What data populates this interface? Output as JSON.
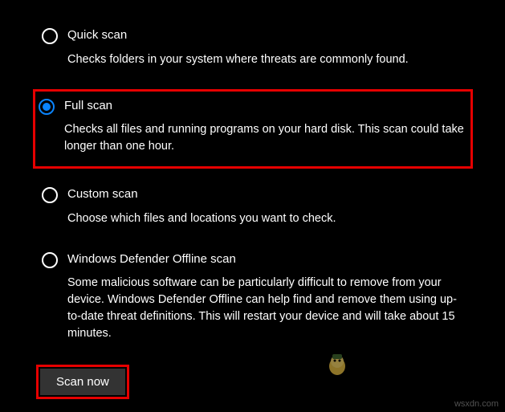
{
  "options": [
    {
      "title": "Quick scan",
      "description": "Checks folders in your system where threats are commonly found.",
      "selected": false,
      "highlighted": false
    },
    {
      "title": "Full scan",
      "description": "Checks all files and running programs on your hard disk. This scan could take longer than one hour.",
      "selected": true,
      "highlighted": true
    },
    {
      "title": "Custom scan",
      "description": "Choose which files and locations you want to check.",
      "selected": false,
      "highlighted": false
    },
    {
      "title": "Windows Defender Offline scan",
      "description": "Some malicious software can be particularly difficult to remove from your device. Windows Defender Offline can help find and remove them using up-to-date threat definitions. This will restart your device and will take about 15 minutes.",
      "selected": false,
      "highlighted": false
    }
  ],
  "scan_button_label": "Scan now",
  "watermark": "wsxdn.com"
}
